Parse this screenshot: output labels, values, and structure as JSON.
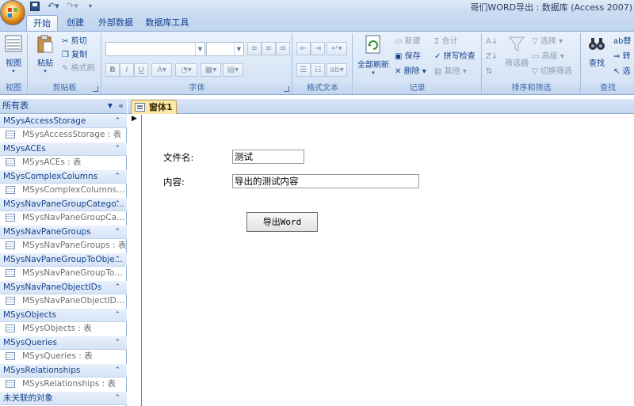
{
  "window": {
    "title": "哥们WORD导出 : 数据库 (Access 2007)"
  },
  "ribbon_tabs": [
    {
      "label": "开始"
    },
    {
      "label": "创建"
    },
    {
      "label": "外部数据"
    },
    {
      "label": "数据库工具"
    }
  ],
  "ribbon": {
    "views": {
      "group": "视图",
      "view": "视图"
    },
    "clipboard": {
      "group": "剪贴板",
      "paste": "粘贴",
      "cut": "剪切",
      "copy": "复制",
      "format_painter": "格式刷"
    },
    "font": {
      "group": "字体",
      "bold": "B",
      "italic": "I",
      "underline": "U"
    },
    "rich_text": {
      "group": "格式文本"
    },
    "records": {
      "group": "记录",
      "refresh_all": "全部刷新",
      "new": "新建",
      "save": "保存",
      "delete": "删除",
      "totals": "合计",
      "spelling": "拼写检查",
      "more": "其他"
    },
    "sort_filter": {
      "group": "排序和筛选",
      "filter": "筛选器",
      "selection": "选择",
      "advanced": "高级",
      "toggle_filter": "切换筛选"
    },
    "find": {
      "group": "查找",
      "find": "查找",
      "replace": "替",
      "goto": "转",
      "select": "选"
    }
  },
  "nav_pane": {
    "header": "所有表",
    "groups": [
      {
        "name": "MSysAccessStorage",
        "items": [
          "MSysAccessStorage : 表"
        ]
      },
      {
        "name": "MSysACEs",
        "items": [
          "MSysACEs : 表"
        ]
      },
      {
        "name": "MSysComplexColumns",
        "items": [
          "MSysComplexColumns : 表"
        ]
      },
      {
        "name": "MSysNavPaneGroupCatego...",
        "items": [
          "MSysNavPaneGroupCate..."
        ]
      },
      {
        "name": "MSysNavPaneGroups",
        "items": [
          "MSysNavPaneGroups : 表"
        ]
      },
      {
        "name": "MSysNavPaneGroupToObje...",
        "items": [
          "MSysNavPaneGroupToOb..."
        ]
      },
      {
        "name": "MSysNavPaneObjectIDs",
        "items": [
          "MSysNavPaneObjectIDs : ..."
        ]
      },
      {
        "name": "MSysObjects",
        "items": [
          "MSysObjects : 表"
        ]
      },
      {
        "name": "MSysQueries",
        "items": [
          "MSysQueries : 表"
        ]
      },
      {
        "name": "MSysRelationships",
        "items": [
          "MSysRelationships : 表"
        ]
      },
      {
        "name": "未关联的对象",
        "items": []
      }
    ]
  },
  "document": {
    "tab_label": "窗体1"
  },
  "form": {
    "filename_label": "文件名:",
    "filename_value": "测试",
    "content_label": "内容:",
    "content_value": "导出的测试内容",
    "export_button": "导出Word"
  }
}
